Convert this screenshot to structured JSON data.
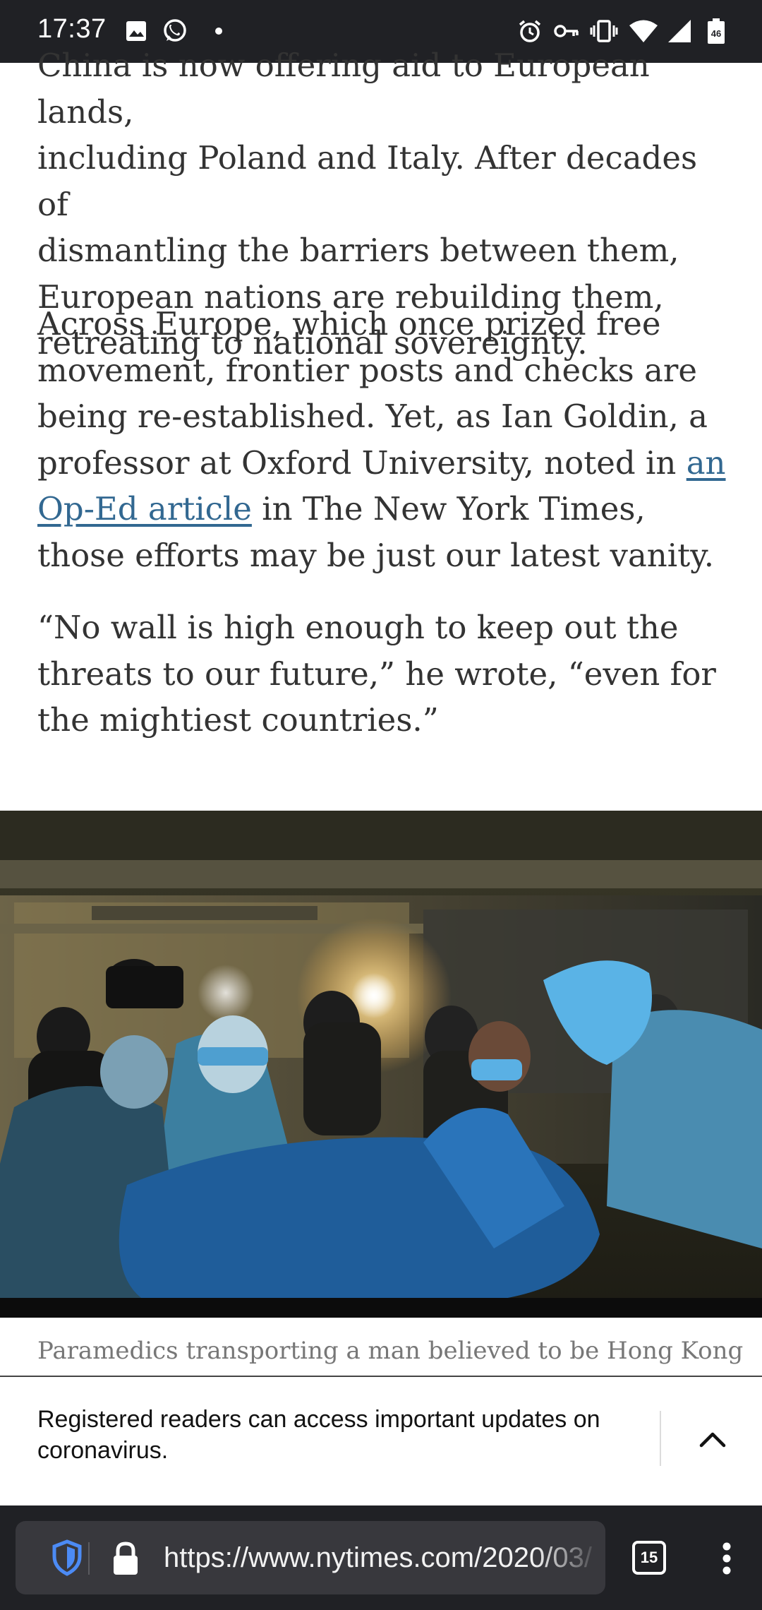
{
  "status_bar": {
    "time": "17:37",
    "left_icons": [
      "gallery-icon",
      "whatsapp-icon",
      "notification-dot-icon"
    ],
    "right_icons": [
      "alarm-icon",
      "vpn-key-icon",
      "vibrate-icon",
      "wifi-icon",
      "signal-icon",
      "battery-icon"
    ],
    "battery_label": "46"
  },
  "article": {
    "paragraph1_lines": [
      "China is now offering aid to European lands,",
      "including Poland and Italy. After decades of",
      "dismantling the barriers between them,",
      "European nations are rebuilding them,",
      "retreating to national sovereignty."
    ],
    "paragraph2_before_link": "Across Europe, which once prized free movement, frontier posts and checks are being re-established. Yet, as Ian Goldin, a professor at Oxford University, noted in ",
    "paragraph2_link": "an Op-Ed article",
    "paragraph2_after_link": " in The New York Times, those efforts may be just our latest vanity.",
    "paragraph3": "“No wall is high enough to keep out the threats to our future,” he wrote, “even for the mightiest countries.”"
  },
  "photo": {
    "caption": "Paramedics transporting a man believed to be Hong Kong’s"
  },
  "registration_banner": {
    "text": "Registered readers can access important updates on coronavirus."
  },
  "browser": {
    "url": "https://www.nytimes.com/2020/03/",
    "tab_count": "15"
  },
  "colors": {
    "status_bar_bg": "#202125",
    "link": "#326891",
    "body_text": "#333333",
    "browser_bar_bg": "#202125",
    "shield_blue": "#4c8bf5"
  }
}
